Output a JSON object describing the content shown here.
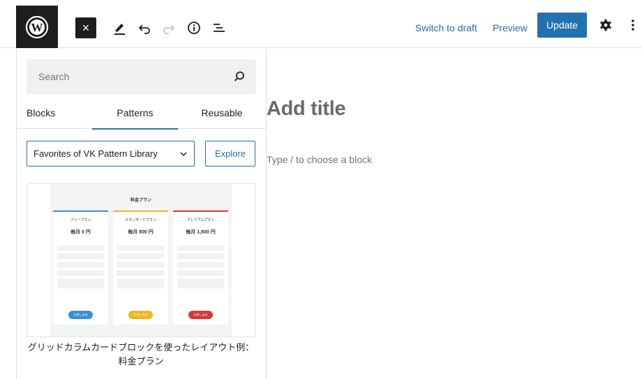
{
  "toolbar": {
    "switch_draft_label": "Switch to draft",
    "preview_label": "Preview",
    "update_label": "Update",
    "close_symbol": "×",
    "icons": [
      "wordpress-logo-icon",
      "close-icon",
      "pen-icon",
      "undo-icon",
      "redo-icon",
      "info-icon",
      "list-view-icon",
      "gear-icon",
      "more-vertical-icon"
    ]
  },
  "inserter": {
    "search": {
      "placeholder": "Search",
      "value": ""
    },
    "tabs": [
      {
        "label": "Blocks",
        "active": false
      },
      {
        "label": "Patterns",
        "active": true
      },
      {
        "label": "Reusable",
        "active": false
      }
    ],
    "category_select": {
      "selected": "Favorites of VK Pattern Library"
    },
    "explore_label": "Explore",
    "pattern": {
      "label": "グリッドカラムカードブロックを使ったレイアウト例：料金プラン",
      "preview": {
        "heading": "料金プラン",
        "plans": [
          {
            "name": "フリープラン",
            "price": "毎月 0 円",
            "button": "お申し込み",
            "color": "#3b8fd6"
          },
          {
            "name": "スタンダードプラン",
            "price": "毎月 800 円",
            "button": "お申し込み",
            "color": "#e8b923"
          },
          {
            "name": "プレミアムプラン",
            "price": "毎月 1,600 円",
            "button": "お申し込み",
            "color": "#d63638"
          }
        ]
      }
    }
  },
  "editor": {
    "title_placeholder": "Add title",
    "block_placeholder": "Type / to choose a block"
  },
  "colors": {
    "accent": "#2271b1",
    "dark": "#1e1e1e",
    "border": "#e0e0e0"
  }
}
